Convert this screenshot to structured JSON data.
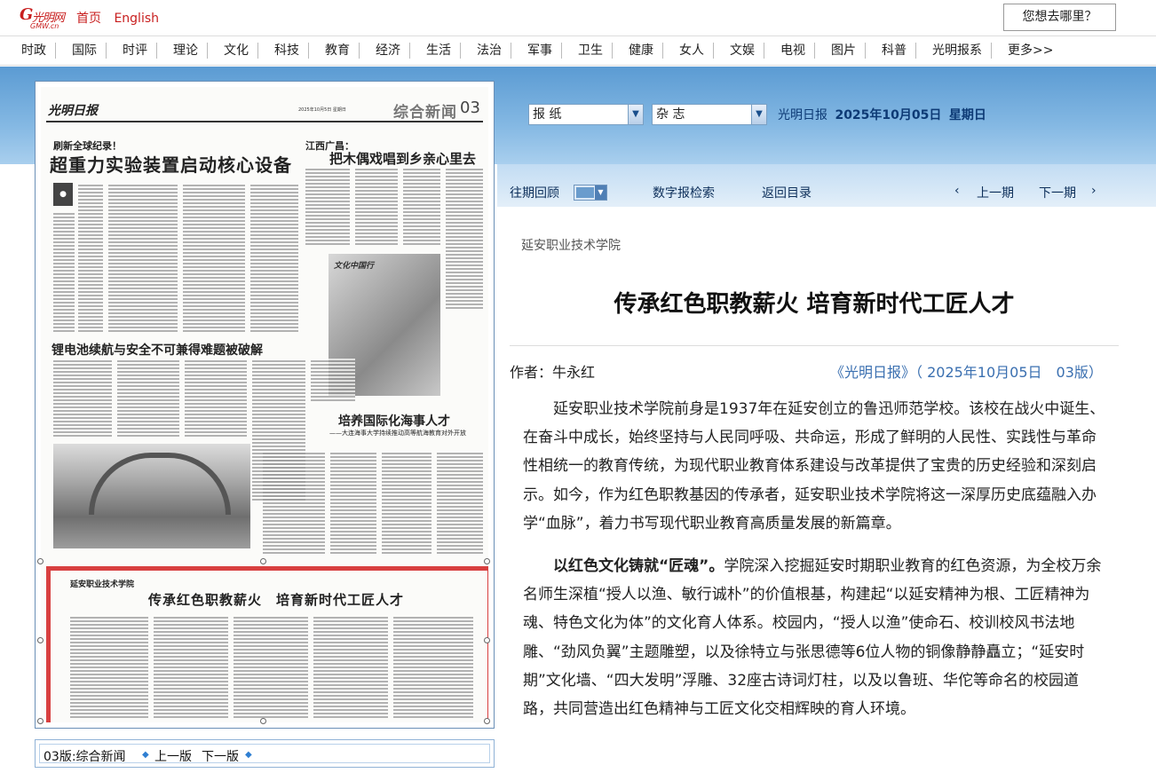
{
  "header": {
    "logo_main": "光明网",
    "logo_sub": "GMW.cn",
    "links": [
      "首页",
      "English"
    ],
    "search_prompt": "您想去哪里？"
  },
  "nav": [
    "时政",
    "国际",
    "时评",
    "理论",
    "文化",
    "科技",
    "教育",
    "经济",
    "生活",
    "法治",
    "军事",
    "卫生",
    "健康",
    "女人",
    "文娱",
    "电视",
    "图片",
    "科普",
    "光明报系",
    "更多>>"
  ],
  "toolbar": {
    "select_paper": "报 纸",
    "select_magazine": "杂 志",
    "paper_name": "光明日报",
    "date": "2025年10月05日",
    "weekday": "星期日",
    "past_issues": "往期回顾",
    "digital_search": "数字报检索",
    "back_to_index": "返回目录",
    "prev_issue": "上一期",
    "next_issue": "下一期"
  },
  "newspaper_page": {
    "masthead": "光明日报",
    "date_line": "2025年10月5日 星期日",
    "section": "综合新闻",
    "page_no": "03",
    "story1_kicker": "刷新全球纪录！",
    "story1_title": "超重力实验装置启动核心设备",
    "story2_kicker": "江西广昌：",
    "story2_title": "把木偶戏唱到乡亲心里去",
    "story2_badge": "文化中国行",
    "story3_title": "锂电池续航与安全不可兼得难题被破解",
    "story4_title": "培养国际化海事人才",
    "story4_sub": "——大连海事大学持续推动高等航海教育对外开放",
    "highlight_school": "延安职业技术学院",
    "highlight_title": "传承红色职教薪火　培育新时代工匠人才"
  },
  "page_footer": {
    "page_label": "03版:综合新闻",
    "prev_page": "上一版",
    "next_page": "下一版"
  },
  "article": {
    "school": "延安职业技术学院",
    "title": "传承红色职教薪火 培育新时代工匠人才",
    "author": "作者：牛永红",
    "source": "《光明日报》（ 2025年10月05日　03版）",
    "para1": "延安职业技术学院前身是1937年在延安创立的鲁迅师范学校。该校在战火中诞生、在奋斗中成长，始终坚持与人民同呼吸、共命运，形成了鲜明的人民性、实践性与革命性相统一的教育传统，为现代职业教育体系建设与改革提供了宝贵的历史经验和深刻启示。如今，作为红色职教基因的传承者，延安职业技术学院将这一深厚历史底蕴融入办学“血脉”，着力书写现代职业教育高质量发展的新篇章。",
    "para2_lead": "以红色文化铸就“匠魂”。",
    "para2_body": "学院深入挖掘延安时期职业教育的红色资源，为全校万余名师生深植“授人以渔、敏行诚朴”的价值根基，构建起“以延安精神为根、工匠精神为魂、特色文化为体”的文化育人体系。校园内，“授人以渔”使命石、校训校风书法地雕、“劲风负翼”主题雕塑，以及徐特立与张思德等6位人物的铜像静静矗立；“延安时期”文化墙、“四大发明”浮雕、32座古诗词灯柱，以及以鲁班、华佗等命名的校园道路，共同营造出红色精神与工匠文化交相辉映的育人环境。"
  },
  "colors": {
    "brand_red": "#c81e1e",
    "band_blue": "#5b9bd3",
    "link_blue": "#3a6fb0",
    "highlight_red": "#d84040"
  }
}
